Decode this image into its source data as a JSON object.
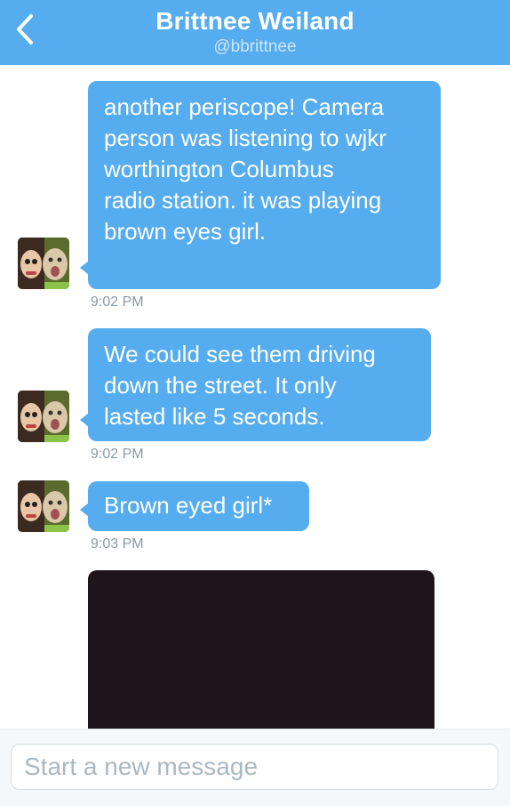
{
  "header": {
    "name": "Brittnee Weiland",
    "handle": "@bbrittnee"
  },
  "messages": [
    {
      "text_lines": [
        "another periscope! Camera",
        "person was listening to wjkr",
        "worthington Columbus",
        "radio station. it was playing",
        "brown eyes girl."
      ],
      "time": "9:02 PM"
    },
    {
      "text_lines": [
        "We could see them driving",
        "down the street. It only",
        "lasted like 5 seconds."
      ],
      "time": "9:02 PM"
    },
    {
      "text_lines": [
        "Brown eyed girl*"
      ],
      "time": "9:03 PM"
    }
  ],
  "composer": {
    "placeholder": "Start a new message"
  },
  "colors": {
    "accent": "#55acee",
    "timestamp": "#8899a6"
  },
  "icons": {
    "back": "chevron-left-icon"
  }
}
